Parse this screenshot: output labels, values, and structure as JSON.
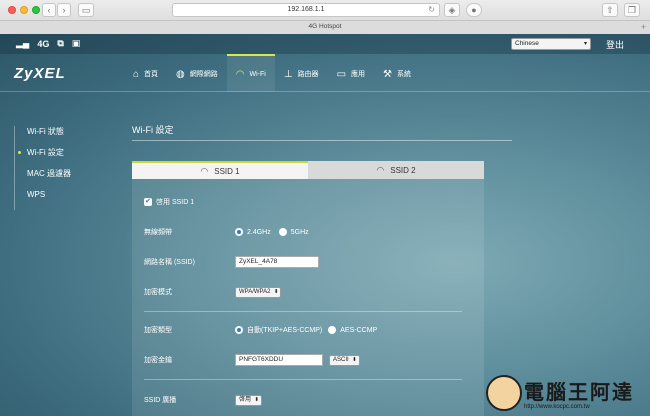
{
  "browser": {
    "address": "192.168.1.1",
    "tab_title": "4G Hotspot",
    "back_icon": "chevron-left-icon",
    "forward_icon": "chevron-right-icon"
  },
  "statusbar": {
    "network_type": "4G",
    "language": "Chinese",
    "logout": "登出"
  },
  "brand": {
    "logo": "ZyXEL"
  },
  "nav": [
    {
      "label": "首頁",
      "icon": "home-icon"
    },
    {
      "label": "網際網路",
      "icon": "globe-icon"
    },
    {
      "label": "Wi-Fi",
      "icon": "wifi-icon",
      "active": true
    },
    {
      "label": "路由器",
      "icon": "router-icon"
    },
    {
      "label": "應用",
      "icon": "monitor-icon"
    },
    {
      "label": "系統",
      "icon": "wrench-icon"
    }
  ],
  "sidebar": [
    {
      "label": "Wi-Fi 狀態"
    },
    {
      "label": "Wi-Fi 設定",
      "active": true
    },
    {
      "label": "MAC 過濾器"
    },
    {
      "label": "WPS"
    }
  ],
  "content": {
    "title": "Wi-Fi 設定",
    "tabs": [
      {
        "label": "SSID 1",
        "active": true
      },
      {
        "label": "SSID 2"
      }
    ],
    "enable_label": "啓用 SSID 1",
    "band": {
      "label": "無線頻帶",
      "opt1": "2.4GHz",
      "opt2": "5GHz"
    },
    "ssid": {
      "label": "網路名稱 (SSID)",
      "value": "ZyXEL_4A78"
    },
    "mode": {
      "label": "加密模式",
      "value": "WPA/WPA2"
    },
    "enc_type": {
      "label": "加密類型",
      "opt1": "自動(TKIP+AES-CCMP)",
      "opt2": "AES-CCMP"
    },
    "key": {
      "label": "加密金鑰",
      "value": "PNFGT6XDDU",
      "format": "ASCII"
    },
    "broadcast": {
      "label": "SSID 廣播",
      "value": "啓用"
    }
  },
  "watermark": {
    "text": "電腦王阿達",
    "url": "http://www.kocpc.com.tw"
  }
}
